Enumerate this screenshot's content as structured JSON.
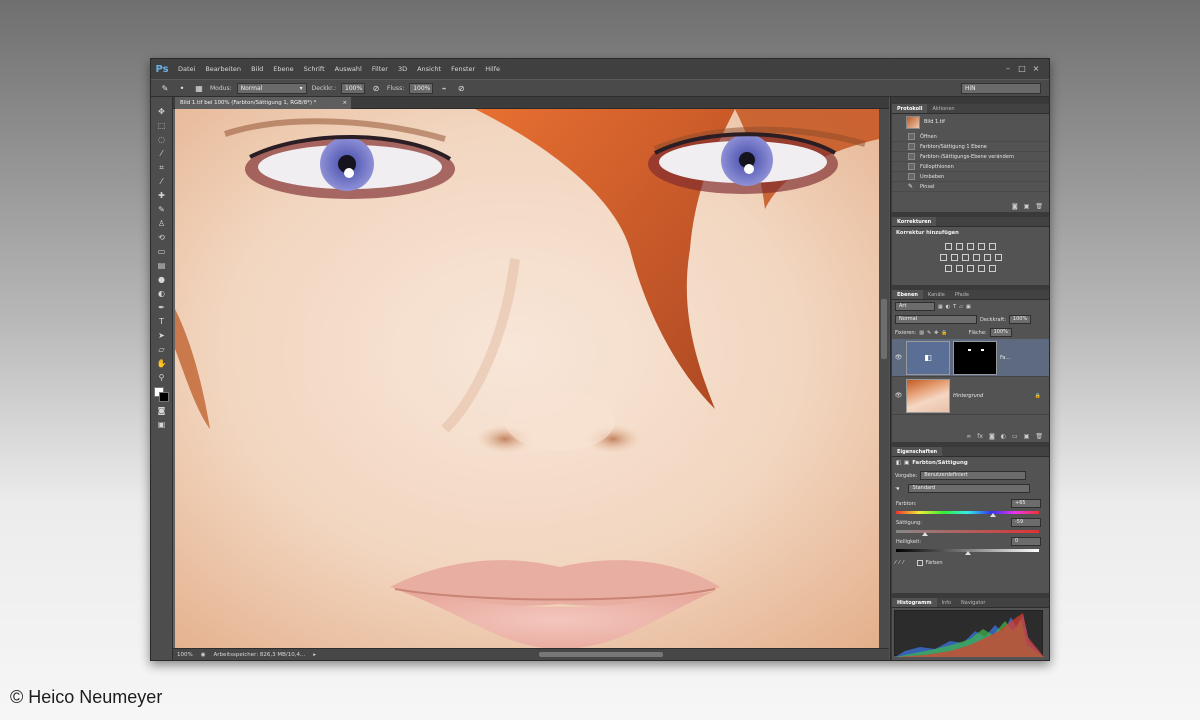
{
  "app": {
    "logo": "Ps"
  },
  "menu": [
    "Datei",
    "Bearbeiten",
    "Bild",
    "Ebene",
    "Schrift",
    "Auswahl",
    "Filter",
    "3D",
    "Ansicht",
    "Fenster",
    "Hilfe"
  ],
  "options_bar": {
    "mode_label": "Modus:",
    "mode_value": "Normal",
    "opacity_label": "Deckkr.:",
    "opacity_value": "100%",
    "flow_label": "Fluss:",
    "flow_value": "100%",
    "workspace_value": "HiN"
  },
  "document": {
    "tab_title": "Bild 1.tif bei 100% (Farbton/Sättigung 1, RGB/8*) *",
    "zoom": "100%",
    "status_text": "Arbeitsspeicher: 826,3 MB/10,4..."
  },
  "history_panel": {
    "tabs": [
      "Protokoll",
      "Aktionen"
    ],
    "snapshot": "Bild 1.tif",
    "steps": [
      "Öffnen",
      "Farbton/Sättigung 1 Ebene",
      "Farbton-/Sättigungs-Ebene verändern",
      "Füllopthionen",
      "Umbeben",
      "Pinsel"
    ]
  },
  "adjustments_panel": {
    "tabs": [
      "Korrekturen"
    ],
    "title": "Korrektur hinzufügen"
  },
  "layers_panel": {
    "tabs": [
      "Ebenen",
      "Kanäle",
      "Pfade"
    ],
    "kind_filter": "Art",
    "blend_mode": "Normal",
    "opacity_label": "Deckkraft:",
    "opacity_value": "100%",
    "lock_label": "Fixieren:",
    "fill_label": "Fläche:",
    "fill_value": "100%",
    "layers": [
      {
        "name": "Fa...",
        "selected": true
      },
      {
        "name": "Hintergrund",
        "selected": false
      }
    ]
  },
  "properties_panel": {
    "tabs": [
      "Eigenschaften"
    ],
    "title": "Farbton/Sättigung",
    "preset_label": "Vorgabe:",
    "preset_value": "Benutzerdefiniert",
    "channel_value": "Standard",
    "hue_label": "Farbton:",
    "hue_value": "+65",
    "hue_fraction": 0.68,
    "saturation_label": "Sättigung:",
    "saturation_value": "-59",
    "saturation_fraction": 0.2,
    "lightness_label": "Helligkeit:",
    "lightness_value": "0",
    "lightness_fraction": 0.5,
    "colorize_label": "Färben"
  },
  "histogram_panel": {
    "tabs": [
      "Histogramm",
      "Info",
      "Navigator"
    ]
  },
  "copyright": "© Heico Neumeyer",
  "colors": {
    "accent_blue": "#5a6f95",
    "panel_bg": "#535353",
    "iris": "#6f72c4",
    "hair": "#d2541f"
  }
}
